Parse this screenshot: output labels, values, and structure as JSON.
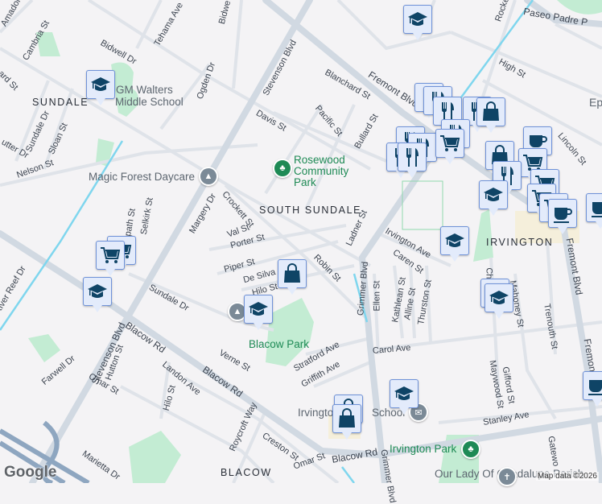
{
  "colors": {
    "background": "#f4f3f5",
    "road": "#d5dce4",
    "park": "#c3ecd3",
    "marker_bg": "#e3ebfb",
    "marker_icon": "#0f4466",
    "canal": "#7fd6ee"
  },
  "areas": [
    "SUNDALE",
    "SOUTH SUNDALE",
    "IRVINGTON",
    "BLACOW"
  ],
  "pois": {
    "school1": "GM Walters",
    "school1b": "Middle School",
    "daycare": "Magic Forest Daycare",
    "irv_school_a": "Irvingto",
    "irv_school_b": "School",
    "church": "Our Lady Of Guadalupe Parish",
    "ep": "Ep"
  },
  "parks": {
    "rosewood_a": "Rosewood",
    "rosewood_b": "Community",
    "rosewood_c": "Park",
    "blacow": "Blacow Park",
    "irvington": "Irvington Park"
  },
  "streets": [
    "Cambria St",
    "Tehama Ave",
    "Bidwell Dr",
    "Bidwe",
    "Ogden Dr",
    "Stevenson Blvd",
    "Davis St",
    "Blanchard St",
    "Fremont Blvd",
    "Pacific St",
    "Bullard St",
    "Sundale Dr",
    "Sloan St",
    "Nelson St",
    "utter Dr",
    "ard St",
    "Selkirk St",
    "idpath St",
    "Margery Dr",
    "Crockett St",
    "Val St",
    "Porter St",
    "Piper St",
    "De Silva",
    "Hilo St",
    "Robin St",
    "Ladner St",
    "Grimmer Blvd",
    "Ellen St",
    "Kathlean St",
    "Alline St",
    "Thurston St",
    "Caren St",
    "Irvington Ave",
    "Chap",
    "Mahoney St",
    "Trenouth St",
    "Fremont Blvd",
    "Fremont Blvd",
    "Carol Ave",
    "Stratford Ave",
    "Griffith Ave",
    "Maywood St",
    "Gifford St",
    "Stanley Ave",
    "Gatewo",
    "Blacow Rd",
    "Grimmer Blvd",
    "Omar St",
    "Creston St",
    "Roycroft Way",
    "Hilo St",
    "Landon Ave",
    "Blacow Rd",
    "Blacow Rd",
    "Verne St",
    "Sundale Dr",
    "Stevenson Blvd",
    "Hutton St",
    "Omar St",
    "Farwell Dr",
    "Marietta Dr",
    "River Reef Dr",
    "Paseo Padre P",
    "High St",
    "Lincoln St",
    "Rocket",
    "Amador"
  ],
  "markers": [
    "school",
    "school",
    "school",
    "cart",
    "school",
    "bag",
    "restaurant",
    "restaurant",
    "restaurant",
    "restaurant",
    "bag",
    "restaurant",
    "restaurant",
    "restaurant",
    "cart",
    "coffee",
    "bag",
    "cart",
    "restaurant",
    "school",
    "school",
    "school",
    "school",
    "cart",
    "coffee",
    "coffee",
    "coffee",
    "bag",
    "school"
  ],
  "footer": "Map data ©2026",
  "logo": "Google"
}
